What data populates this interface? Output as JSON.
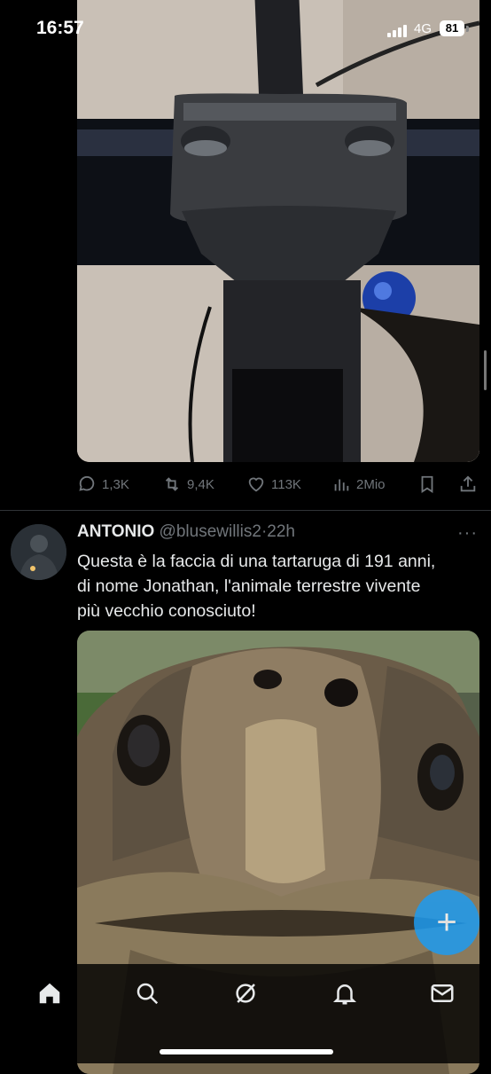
{
  "status_bar": {
    "time": "16:57",
    "network": "4G",
    "battery": "81"
  },
  "tweet1": {
    "image_subject": "bicycle-stem-face",
    "stats": {
      "replies": "1,3K",
      "reposts": "9,4K",
      "likes": "113K",
      "views": "2Mio"
    }
  },
  "tweet2": {
    "name": "ANTONIO",
    "handle": "@blusewillis2",
    "separator": "·",
    "time": "22h",
    "more": "···",
    "text": "Questa è la faccia di una tartaruga di 191 anni,\ndi nome Jonathan, l'animale terrestre vivente\npiù vecchio conosciuto!",
    "image_subject": "tortoise-face"
  },
  "fab": {
    "label": "+"
  },
  "nav": [
    "home-icon",
    "search-icon",
    "grok-icon",
    "notifications-icon",
    "messages-icon"
  ],
  "colors": {
    "accent": "#1d9bf0",
    "muted": "#71767b",
    "text": "#e7e9ea",
    "divider": "#2f3336"
  }
}
